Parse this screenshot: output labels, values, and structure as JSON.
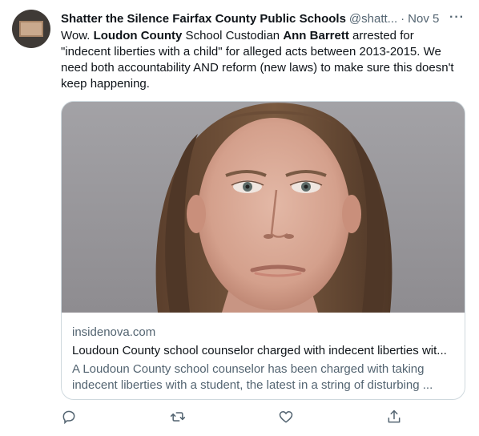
{
  "tweet": {
    "display_name": "Shatter the Silence Fairfax County Public Schools",
    "handle": "@shatt...",
    "separator": "·",
    "date": "Nov 5",
    "more_label": "···",
    "text": {
      "t1": "Wow. ",
      "b1": "Loudon County",
      "t2": " School Custodian ",
      "b2": "Ann Barrett",
      "t3": " arrested for \"indecent liberties with a child\" for alleged acts between 2013-2015. We need both accountability AND reform (new laws) to make sure this doesn't keep happening."
    }
  },
  "card": {
    "domain": "insidenova.com",
    "title": "Loudoun County school counselor charged with indecent liberties wit...",
    "description": "A Loudoun County school counselor has been charged with taking indecent liberties with a student, the latest in a string of disturbing ..."
  },
  "actions": {
    "icons": [
      "reply-icon",
      "retweet-icon",
      "like-icon",
      "share-icon"
    ]
  },
  "colors": {
    "text": "#0f1419",
    "secondary": "#536471",
    "border": "#cfd9de"
  }
}
